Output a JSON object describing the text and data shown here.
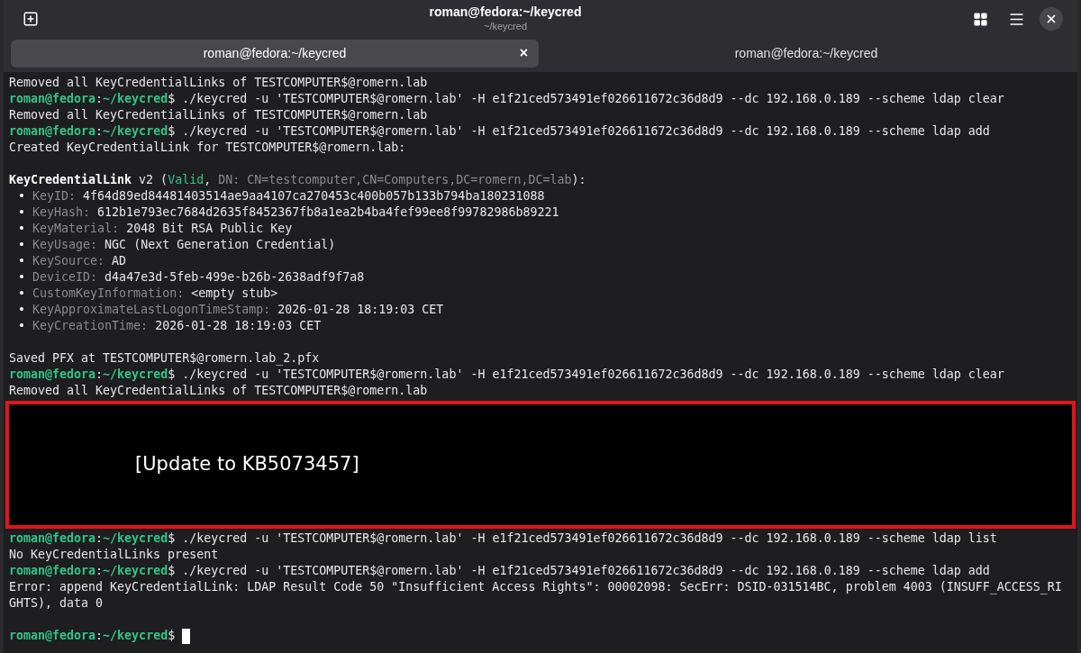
{
  "window": {
    "title": "roman@fedora:~/keycred",
    "subtitle": "~/keycred"
  },
  "tabs": [
    {
      "label": "roman@fedora:~/keycred",
      "selected": true,
      "close": "×"
    },
    {
      "label": "roman@fedora:~/keycred",
      "selected": false
    }
  ],
  "terminal": {
    "lines_before": [
      {
        "kind": "output",
        "text": "Removed all KeyCredentialLinks of TESTCOMPUTER$@romern.lab"
      },
      {
        "kind": "prompt",
        "user_host": "roman@fedora",
        "sep": ":",
        "path": "~/keycred",
        "symbol": "$",
        "command": " ./keycred -u 'TESTCOMPUTER$@romern.lab' -H e1f21ced573491ef026611672c36d8d9 --dc 192.168.0.189 --scheme ldap clear"
      },
      {
        "kind": "output",
        "text": "Removed all KeyCredentialLinks of TESTCOMPUTER$@romern.lab"
      },
      {
        "kind": "prompt",
        "user_host": "roman@fedora",
        "sep": ":",
        "path": "~/keycred",
        "symbol": "$",
        "command": " ./keycred -u 'TESTCOMPUTER$@romern.lab' -H e1f21ced573491ef026611672c36d8d9 --dc 192.168.0.189 --scheme ldap add"
      },
      {
        "kind": "output",
        "text": "Created KeyCredentialLink for TESTCOMPUTER$@romern.lab:"
      },
      {
        "kind": "blank"
      },
      {
        "kind": "segments",
        "segments": [
          {
            "text": "KeyCredentialLink",
            "kind": "bold"
          },
          {
            "text": " v2 (",
            "kind": "plain"
          },
          {
            "text": "Valid",
            "kind": "green"
          },
          {
            "text": ", ",
            "kind": "plain"
          },
          {
            "text": "DN: CN=testcomputer,CN=Computers,DC=romern,DC=lab",
            "kind": "dim"
          },
          {
            "text": "):",
            "kind": "plain"
          }
        ]
      },
      {
        "kind": "item",
        "bullet": "•",
        "key": "KeyID:",
        "value": "4f64d89ed84481403514ae9aa4107ca270453c400b057b133b794ba180231088"
      },
      {
        "kind": "item",
        "bullet": "•",
        "key": "KeyHash:",
        "value": "612b1e793ec7684d2635f8452367fb8a1ea2b4ba4fef99ee8f99782986b89221"
      },
      {
        "kind": "item",
        "bullet": "•",
        "key": "KeyMaterial:",
        "value": "2048 Bit RSA Public Key"
      },
      {
        "kind": "item",
        "bullet": "•",
        "key": "KeyUsage:",
        "value": "NGC (Next Generation Credential)"
      },
      {
        "kind": "item",
        "bullet": "•",
        "key": "KeySource:",
        "value": "AD"
      },
      {
        "kind": "item",
        "bullet": "•",
        "key": "DeviceID:",
        "value": "d4a47e3d-5feb-499e-b26b-2638adf9f7a8"
      },
      {
        "kind": "item",
        "bullet": "•",
        "key": "CustomKeyInformation:",
        "value": "<empty stub>"
      },
      {
        "kind": "item",
        "bullet": "•",
        "key": "KeyApproximateLastLogonTimeStamp:",
        "value": "2026-01-28 18:19:03 CET"
      },
      {
        "kind": "item",
        "bullet": "•",
        "key": "KeyCreationTime:",
        "value": "2026-01-28 18:19:03 CET"
      },
      {
        "kind": "blank"
      },
      {
        "kind": "output",
        "text": "Saved PFX at TESTCOMPUTER$@romern.lab_2.pfx"
      },
      {
        "kind": "prompt",
        "user_host": "roman@fedora",
        "sep": ":",
        "path": "~/keycred",
        "symbol": "$",
        "command": " ./keycred -u 'TESTCOMPUTER$@romern.lab' -H e1f21ced573491ef026611672c36d8d9 --dc 192.168.0.189 --scheme ldap clear"
      },
      {
        "kind": "output",
        "text": "Removed all KeyCredentialLinks of TESTCOMPUTER$@romern.lab"
      }
    ],
    "annotation": {
      "text": "[Update to KB5073457]"
    },
    "lines_after": [
      {
        "kind": "prompt",
        "user_host": "roman@fedora",
        "sep": ":",
        "path": "~/keycred",
        "symbol": "$",
        "command": " ./keycred -u 'TESTCOMPUTER$@romern.lab' -H e1f21ced573491ef026611672c36d8d9 --dc 192.168.0.189 --scheme ldap list"
      },
      {
        "kind": "output",
        "text": "No KeyCredentialLinks present"
      },
      {
        "kind": "prompt",
        "user_host": "roman@fedora",
        "sep": ":",
        "path": "~/keycred",
        "symbol": "$",
        "command": " ./keycred -u 'TESTCOMPUTER$@romern.lab' -H e1f21ced573491ef026611672c36d8d9 --dc 192.168.0.189 --scheme ldap add"
      },
      {
        "kind": "output",
        "text": "Error: append KeyCredentialLink: LDAP Result Code 50 \"Insufficient Access Rights\": 00002098: SecErr: DSID-031514BC, problem 4003 (INSUFF_ACCESS_RI"
      },
      {
        "kind": "output",
        "text": "GHTS), data 0"
      },
      {
        "kind": "blank"
      },
      {
        "kind": "prompt",
        "user_host": "roman@fedora",
        "sep": ":",
        "path": "~/keycred",
        "symbol": "$",
        "cursor": true
      }
    ]
  }
}
